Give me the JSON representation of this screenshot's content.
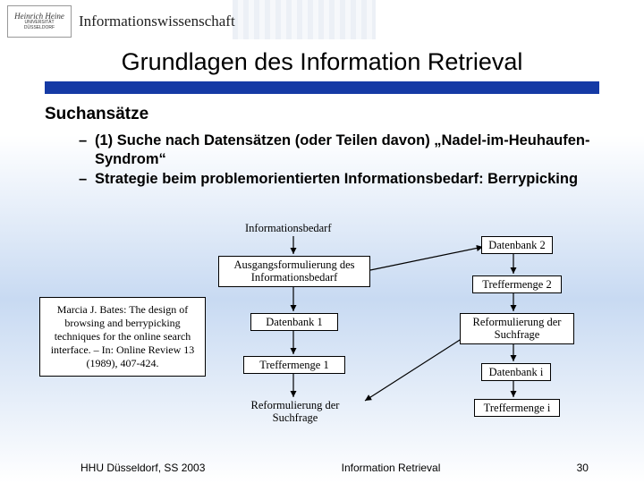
{
  "header": {
    "logo_top": "Heinrich Heine",
    "logo_mid": "UNIVERSITÄT",
    "logo_bot": "DÜSSELDORF",
    "department": "Informationswissenschaft"
  },
  "title": "Grundlagen des Information Retrieval",
  "section_heading": "Suchansätze",
  "bullets": [
    "(1) Suche nach Datensätzen (oder Teilen davon) „Nadel-im-Heuhaufen-Syndrom“",
    "Strategie beim problemorientierten Informationsbedarf: Berrypicking"
  ],
  "diagram": {
    "top": "Informationsbedarf",
    "ausg": "Ausgangsformulierung des\nInformationsbedarf",
    "db1": "Datenbank 1",
    "tm1": "Treffermenge 1",
    "reform": "Reformulierung der\nSuchfrage",
    "db2": "Datenbank 2",
    "tm2": "Treffermenge 2",
    "reform2": "Reformulierung der\nSuchfrage",
    "dbi": "Datenbank i",
    "tmi": "Treffermenge i"
  },
  "citation": "Marcia J. Bates: The design of browsing and berrypicking techniques for the online search interface. – In: Online Review 13 (1989), 407-424.",
  "footer": {
    "left": "HHU Düsseldorf, SS 2003",
    "center": "Information Retrieval",
    "right": "30"
  }
}
